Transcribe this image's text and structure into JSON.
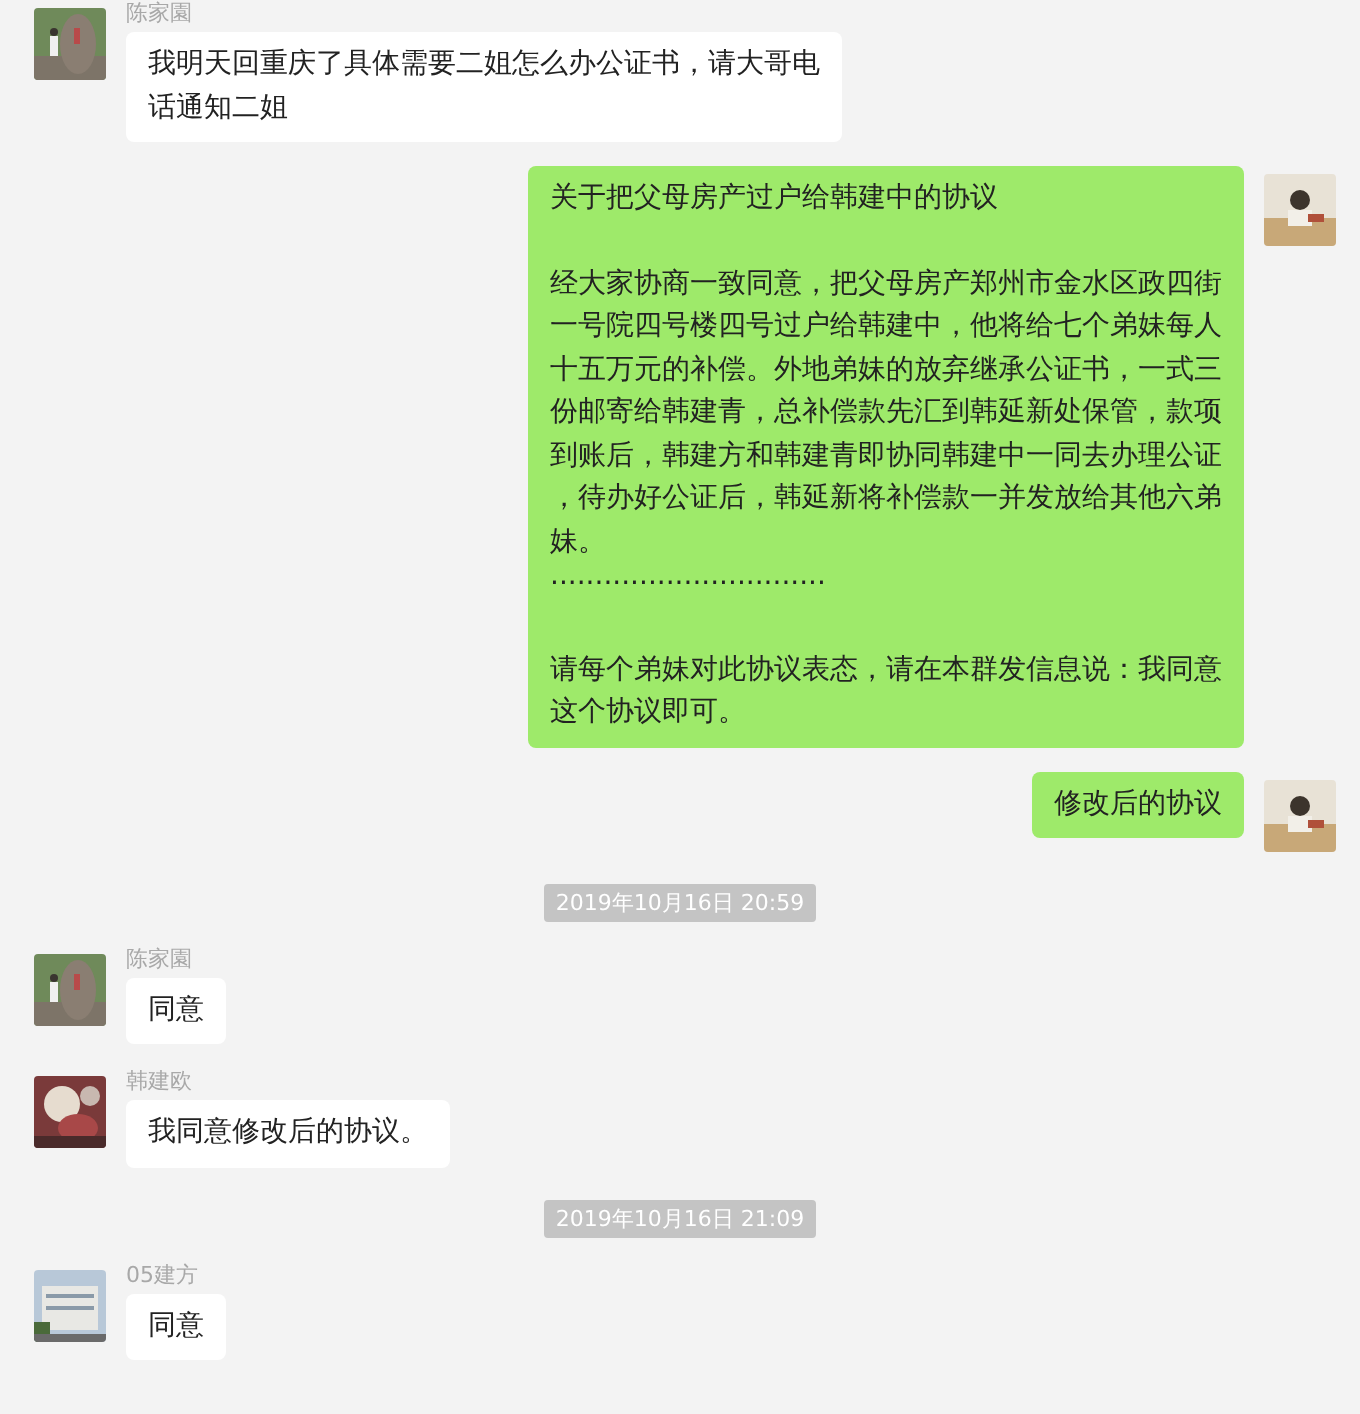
{
  "messages": [
    {
      "kind": "received",
      "sender": "陈家園",
      "paragraphs": [
        {
          "lines": [
            "我明天回重庆了具体需要二姐怎么办公证书，请大哥电",
            "话通知二姐"
          ]
        }
      ]
    },
    {
      "kind": "sent",
      "paragraphs": [
        {
          "lines": [
            "关于把父母房产过户给韩建中的协议"
          ]
        },
        {
          "lines": [
            "经大家协商一致同意，把父母房产郑州市金水区政四街",
            "一号院四号楼四号过户给韩建中，他将给七个弟妹每人",
            "十五万元的补偿。外地弟妹的放弃继承公证书，一式三",
            "份邮寄给韩建青，总补偿款先汇到韩延新处保管，款项",
            "到账后，韩建方和韩建青即协同韩建中一同去办理公证",
            "，待办好公证后，韩延新将补偿款一并发放给其他六弟",
            "妹。",
            "·······························"
          ]
        },
        {
          "lines": [
            "请每个弟妹对此协议表态，请在本群发信息说：我同意",
            "这个协议即可。"
          ]
        }
      ]
    },
    {
      "kind": "sent",
      "paragraphs": [
        {
          "lines": [
            "修改后的协议"
          ]
        }
      ]
    },
    {
      "kind": "time",
      "text": "2019年10月16日 20:59"
    },
    {
      "kind": "received",
      "sender": "陈家園",
      "paragraphs": [
        {
          "lines": [
            "同意"
          ]
        }
      ]
    },
    {
      "kind": "received",
      "sender": "韩建欧",
      "paragraphs": [
        {
          "lines": [
            "我同意修改后的协议。"
          ]
        }
      ]
    },
    {
      "kind": "time",
      "text": "2019年10月16日 21:09"
    },
    {
      "kind": "received",
      "sender": "05建方",
      "paragraphs": [
        {
          "lines": [
            "同意"
          ]
        }
      ]
    }
  ]
}
